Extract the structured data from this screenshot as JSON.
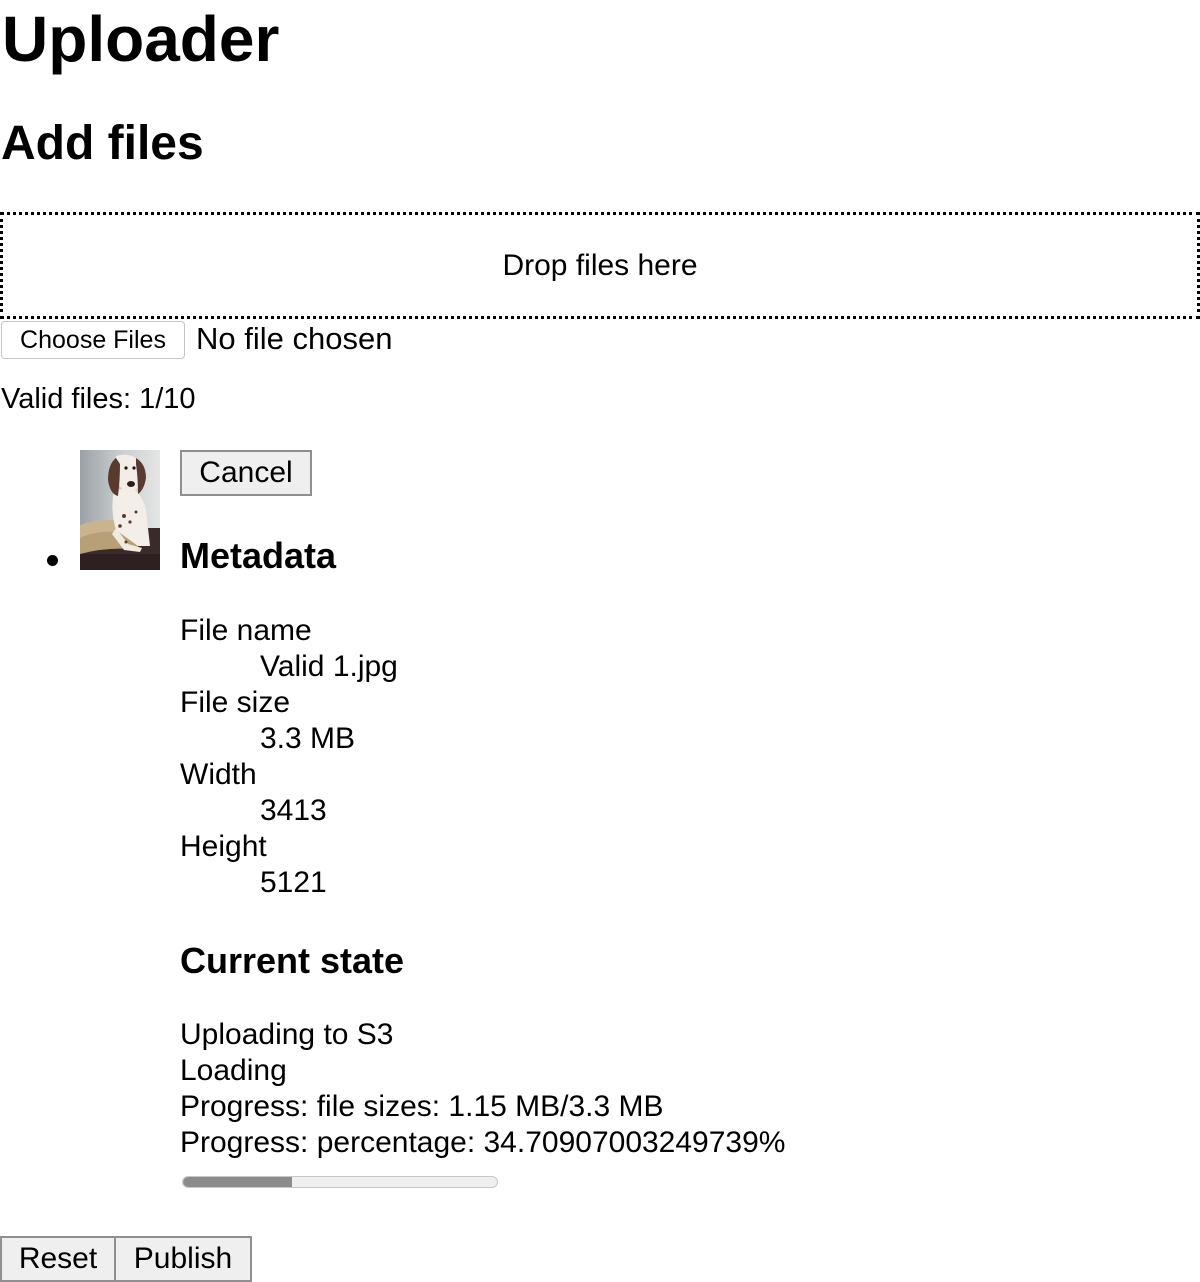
{
  "page": {
    "title": "Uploader",
    "subtitle": "Add files"
  },
  "dropzone": {
    "label": "Drop files here"
  },
  "file_input": {
    "button_label": "Choose Files",
    "status": "No file chosen"
  },
  "summary": {
    "valid_files": "Valid files: 1/10"
  },
  "file_item": {
    "thumbnail_icon": "dog-photo-thumbnail",
    "cancel_label": "Cancel",
    "metadata": {
      "heading": "Metadata",
      "file_name_label": "File name",
      "file_name_value": "Valid 1.jpg",
      "file_size_label": "File size",
      "file_size_value": "3.3 MB",
      "width_label": "Width",
      "width_value": "3413",
      "height_label": "Height",
      "height_value": "5121"
    },
    "state": {
      "heading": "Current state",
      "line1": "Uploading to S3",
      "line2": "Loading",
      "line3": "Progress: file sizes: 1.15 MB/3.3 MB",
      "line4": "Progress: percentage: 34.70907003249739%",
      "progress_percent": 34.70907003249739
    }
  },
  "actions": {
    "reset_label": "Reset",
    "publish_label": "Publish"
  },
  "colors": {
    "progress_fill": "#8c8c8c",
    "progress_track": "#efefef",
    "button_bg": "#efefef"
  }
}
